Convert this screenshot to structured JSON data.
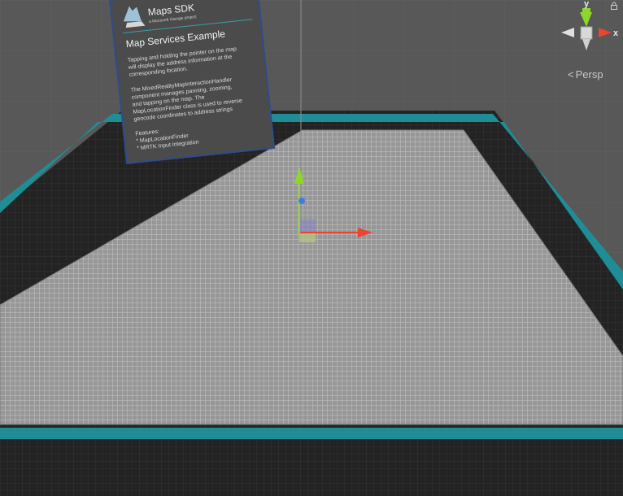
{
  "panel": {
    "logo_title": "Maps SDK",
    "logo_subtitle": "a Microsoft Garage project",
    "title": "Map Services Example",
    "para1": [
      "Tapping and holding the pointer on the map",
      "will display the address information at the",
      "corresponding location."
    ],
    "para2": [
      "The MixedRealityMapInteractionHandler",
      "component manages panning, zooming,",
      "and tapping on the map.  The",
      "MapLocationFinder class is used to reverse",
      "geocode coordinates to address strings"
    ],
    "features_heading": "Features:",
    "features": [
      "* MapLocationFinder",
      "* MRTK Input integration"
    ]
  },
  "gizmo": {
    "x_label": "x",
    "y_label": "y",
    "projection_label": "Persp",
    "x_color": "#e8462e",
    "y_color": "#8dd62a",
    "z_color": "#3a7ee8"
  },
  "scene": {
    "border_color": "#1f8d96",
    "map_color": "#9a9a9a"
  }
}
